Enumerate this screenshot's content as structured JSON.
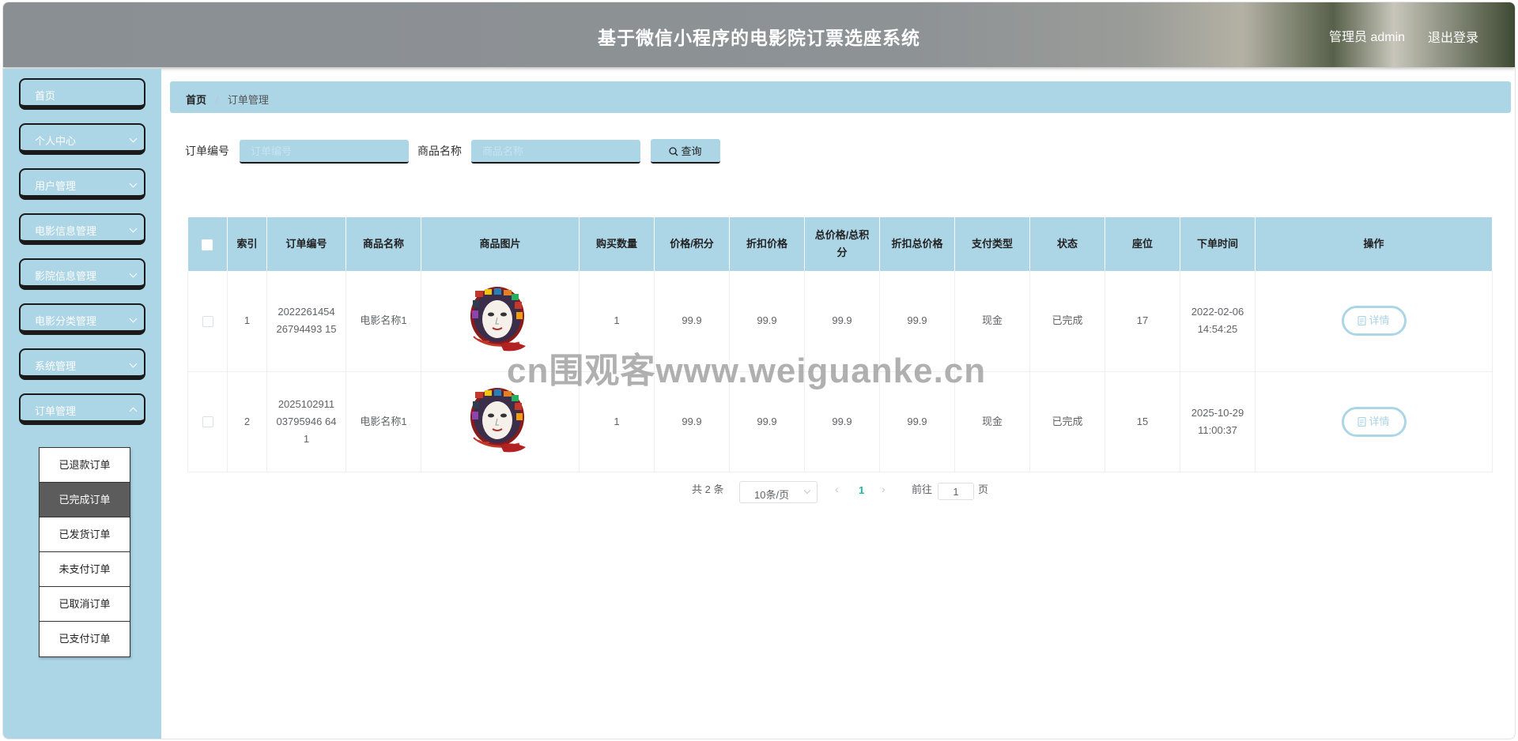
{
  "header": {
    "title": "基于微信小程序的电影院订票选座系统",
    "admin_label": "管理员 admin",
    "logout_label": "退出登录"
  },
  "sidebar": {
    "items": [
      {
        "label": "首页"
      },
      {
        "label": "个人中心"
      },
      {
        "label": "用户管理"
      },
      {
        "label": "电影信息管理"
      },
      {
        "label": "影院信息管理"
      },
      {
        "label": "电影分类管理"
      },
      {
        "label": "系统管理"
      },
      {
        "label": "订单管理"
      }
    ],
    "submenu": [
      {
        "label": "已退款订单"
      },
      {
        "label": "已完成订单"
      },
      {
        "label": "已发货订单"
      },
      {
        "label": "未支付订单"
      },
      {
        "label": "已取消订单"
      },
      {
        "label": "已支付订单"
      }
    ]
  },
  "breadcrumb": {
    "home": "首页",
    "separator": "/",
    "current": "订单管理"
  },
  "search": {
    "order_no_label": "订单编号",
    "order_no_placeholder": "订单编号",
    "product_name_label": "商品名称",
    "product_name_placeholder": "商品名称",
    "query_label": "查询"
  },
  "table": {
    "headers": [
      "索引",
      "订单编号",
      "商品名称",
      "商品图片",
      "购买数量",
      "价格/积分",
      "折扣价格",
      "总价格/总积分",
      "折扣总价格",
      "支付类型",
      "状态",
      "座位",
      "下单时间",
      "操作"
    ],
    "rows": [
      {
        "index": "1",
        "order_no": "202226145426794493 15",
        "product_name": "电影名称1",
        "quantity": "1",
        "price": "99.9",
        "discount_price": "99.9",
        "total": "99.9",
        "discount_total": "99.9",
        "pay_type": "现金",
        "status": "已完成",
        "seat": "17",
        "time": "2022-02-06 14:54:25",
        "action": "详情"
      },
      {
        "index": "2",
        "order_no": "202510291103795946 641",
        "product_name": "电影名称1",
        "quantity": "1",
        "price": "99.9",
        "discount_price": "99.9",
        "total": "99.9",
        "discount_total": "99.9",
        "pay_type": "现金",
        "status": "已完成",
        "seat": "15",
        "time": "2025-10-29 11:00:37",
        "action": "详情"
      }
    ]
  },
  "pagination": {
    "total_text": "共 2 条",
    "page_size": "10条/页",
    "current_page": "1",
    "goto_label": "前往",
    "goto_value": "1",
    "page_suffix": "页"
  },
  "watermark": "cn围观客www.weiguanke.cn",
  "colors": {
    "accent": "#acd5e6",
    "active_submenu": "#5c5c5c",
    "current_page": "#1abc9c"
  }
}
